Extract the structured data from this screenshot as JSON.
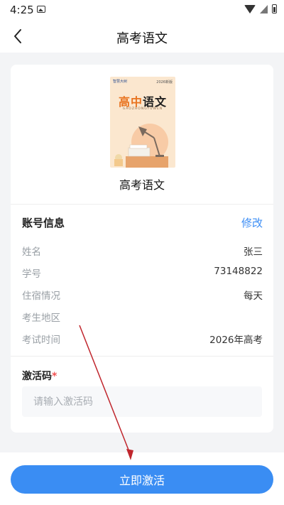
{
  "status_bar": {
    "time": "4:25",
    "icons": [
      "image-icon",
      "wifi-icon",
      "signal-icon",
      "battery-icon"
    ]
  },
  "nav": {
    "title": "高考语文",
    "back_icon": "chevron-left-icon"
  },
  "book": {
    "cover": {
      "brand": "智慧大树",
      "edition": "2026新版",
      "title_part1": "高中",
      "title_part2": "语文",
      "pinyin": "GAOZHONGYUWEN"
    },
    "name": "高考语文"
  },
  "account": {
    "section_title": "账号信息",
    "edit_label": "修改",
    "fields": [
      {
        "label": "姓名",
        "value": "张三"
      },
      {
        "label": "学号",
        "value": "73148822"
      },
      {
        "label": "住宿情况",
        "value": "每天"
      },
      {
        "label": "考生地区",
        "value": ""
      },
      {
        "label": "考试时间",
        "value": "2026年高考"
      }
    ]
  },
  "activation": {
    "label": "激活码",
    "required_mark": "*",
    "placeholder": "请输入激活码",
    "value": ""
  },
  "bottom": {
    "activate_label": "立即激活"
  },
  "colors": {
    "accent": "#3a8df3",
    "required": "#f15151",
    "annotation": "#c0262d"
  }
}
